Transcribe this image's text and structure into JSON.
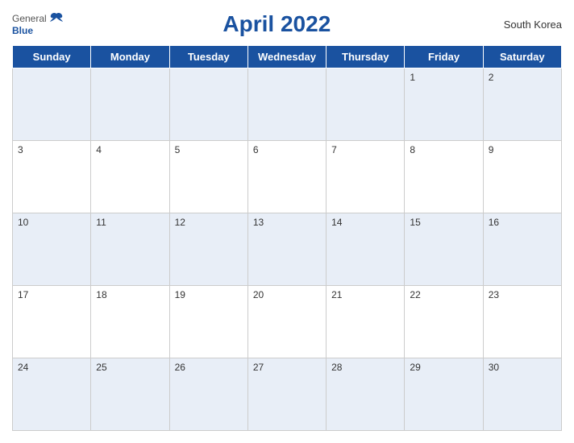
{
  "header": {
    "logo_general": "General",
    "logo_blue": "Blue",
    "title": "April 2022",
    "country": "South Korea"
  },
  "weekdays": [
    "Sunday",
    "Monday",
    "Tuesday",
    "Wednesday",
    "Thursday",
    "Friday",
    "Saturday"
  ],
  "weeks": [
    [
      {
        "day": "",
        "empty": true
      },
      {
        "day": "",
        "empty": true
      },
      {
        "day": "",
        "empty": true
      },
      {
        "day": "",
        "empty": true
      },
      {
        "day": "",
        "empty": true
      },
      {
        "day": "1",
        "empty": false
      },
      {
        "day": "2",
        "empty": false
      }
    ],
    [
      {
        "day": "3",
        "empty": false
      },
      {
        "day": "4",
        "empty": false
      },
      {
        "day": "5",
        "empty": false
      },
      {
        "day": "6",
        "empty": false
      },
      {
        "day": "7",
        "empty": false
      },
      {
        "day": "8",
        "empty": false
      },
      {
        "day": "9",
        "empty": false
      }
    ],
    [
      {
        "day": "10",
        "empty": false
      },
      {
        "day": "11",
        "empty": false
      },
      {
        "day": "12",
        "empty": false
      },
      {
        "day": "13",
        "empty": false
      },
      {
        "day": "14",
        "empty": false
      },
      {
        "day": "15",
        "empty": false
      },
      {
        "day": "16",
        "empty": false
      }
    ],
    [
      {
        "day": "17",
        "empty": false
      },
      {
        "day": "18",
        "empty": false
      },
      {
        "day": "19",
        "empty": false
      },
      {
        "day": "20",
        "empty": false
      },
      {
        "day": "21",
        "empty": false
      },
      {
        "day": "22",
        "empty": false
      },
      {
        "day": "23",
        "empty": false
      }
    ],
    [
      {
        "day": "24",
        "empty": false
      },
      {
        "day": "25",
        "empty": false
      },
      {
        "day": "26",
        "empty": false
      },
      {
        "day": "27",
        "empty": false
      },
      {
        "day": "28",
        "empty": false
      },
      {
        "day": "29",
        "empty": false
      },
      {
        "day": "30",
        "empty": false
      }
    ]
  ]
}
